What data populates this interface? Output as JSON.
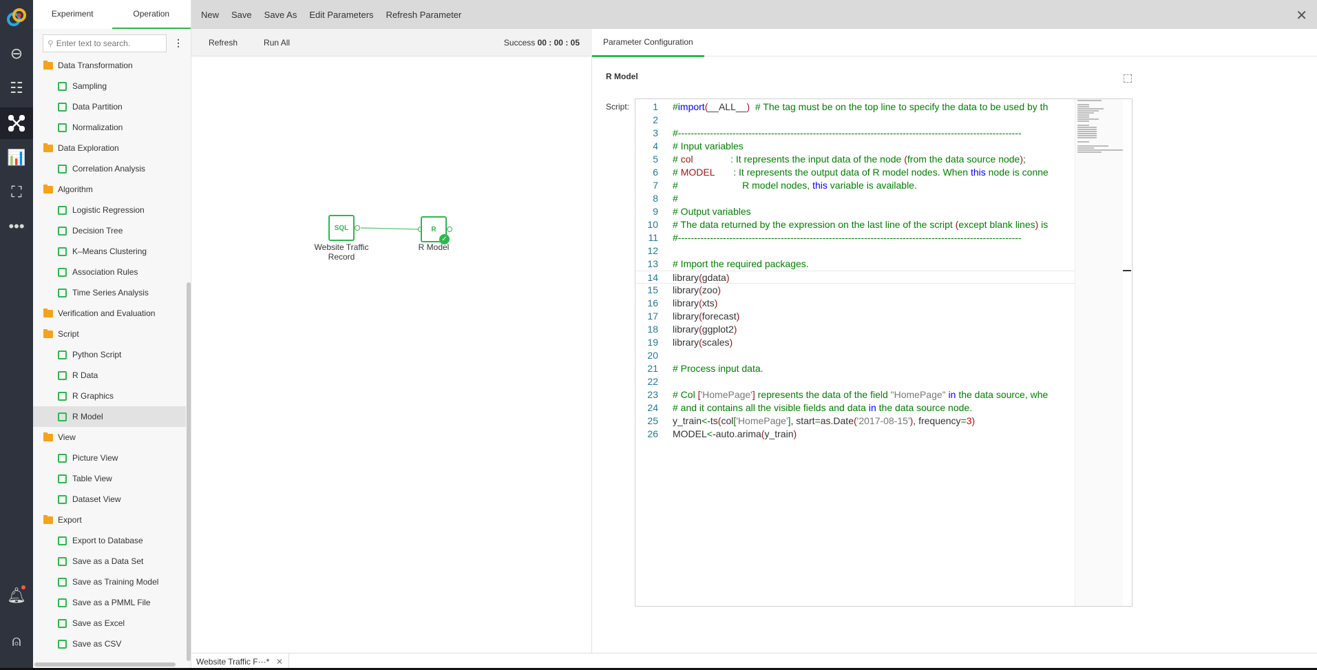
{
  "rail": {
    "icons": [
      "logo-icon",
      "link-icon",
      "list-icon",
      "network-icon",
      "chart-icon",
      "presentation-icon",
      "more-icon",
      "bell-icon",
      "user-icon"
    ],
    "accent": "#2db84d"
  },
  "sidebar": {
    "tabs": [
      "Experiment",
      "Operation"
    ],
    "search_placeholder": "Enter text to search.",
    "tree": [
      {
        "type": "cat",
        "label": "Data Transformation"
      },
      {
        "type": "item",
        "label": "Sampling"
      },
      {
        "type": "item",
        "label": "Data Partition"
      },
      {
        "type": "item",
        "label": "Normalization"
      },
      {
        "type": "cat",
        "label": "Data Exploration"
      },
      {
        "type": "item",
        "label": "Correlation Analysis"
      },
      {
        "type": "cat",
        "label": "Algorithm"
      },
      {
        "type": "item",
        "label": "Logistic Regression"
      },
      {
        "type": "item",
        "label": "Decision Tree"
      },
      {
        "type": "item",
        "label": "K–Means Clustering"
      },
      {
        "type": "item",
        "label": "Association Rules"
      },
      {
        "type": "item",
        "label": "Time Series Analysis"
      },
      {
        "type": "cat",
        "label": "Verification and Evaluation"
      },
      {
        "type": "cat",
        "label": "Script"
      },
      {
        "type": "item",
        "label": "Python Script"
      },
      {
        "type": "item",
        "label": "R Data"
      },
      {
        "type": "item",
        "label": "R Graphics"
      },
      {
        "type": "item",
        "label": "R Model",
        "selected": true
      },
      {
        "type": "cat",
        "label": "View"
      },
      {
        "type": "item",
        "label": "Picture View"
      },
      {
        "type": "item",
        "label": "Table View"
      },
      {
        "type": "item",
        "label": "Dataset View"
      },
      {
        "type": "cat",
        "label": "Export"
      },
      {
        "type": "item",
        "label": "Export to Database"
      },
      {
        "type": "item",
        "label": "Save as a Data Set"
      },
      {
        "type": "item",
        "label": "Save as Training Model"
      },
      {
        "type": "item",
        "label": "Save as a PMML File"
      },
      {
        "type": "item",
        "label": "Save as Excel"
      },
      {
        "type": "item",
        "label": "Save as CSV"
      }
    ]
  },
  "toolbar": {
    "items": [
      "New",
      "Save",
      "Save As",
      "Edit Parameters",
      "Refresh Parameter"
    ]
  },
  "canvas": {
    "refresh": "Refresh",
    "run_all": "Run All",
    "status_label": "Success",
    "status_time": "00 : 00 : 05",
    "nodes": [
      {
        "label": "Website Traffic Record",
        "icon": "SQL"
      },
      {
        "label": "R Model",
        "icon": "R",
        "status": "success"
      }
    ]
  },
  "panel": {
    "tab": "Parameter Configuration",
    "title": "R Model",
    "script_label": "Script:"
  },
  "code": [
    [
      [
        "c",
        "#"
      ],
      [
        "k",
        "import"
      ],
      [
        "o",
        "("
      ],
      [
        "t",
        "__ALL__"
      ],
      [
        "o",
        ")"
      ],
      [
        "c",
        "  # The tag must be on the top line to specify the data to be used by th"
      ]
    ],
    [],
    [
      [
        "c",
        "#-----------------------------------------------------------------------------------------------------------"
      ]
    ],
    [
      [
        "c",
        "# Input variables"
      ]
    ],
    [
      [
        "c",
        "# "
      ],
      [
        "o",
        "col"
      ],
      [
        "c",
        "              : It represents the input data of the node "
      ],
      [
        "o",
        "("
      ],
      [
        "c",
        "from the data source node"
      ],
      [
        "o",
        ")"
      ],
      [
        "c",
        ";"
      ]
    ],
    [
      [
        "c",
        "# "
      ],
      [
        "o",
        "MODEL"
      ],
      [
        "c",
        "       : It represents the output data of R model nodes. When "
      ],
      [
        "k",
        "this"
      ],
      [
        "c",
        " node is conne"
      ]
    ],
    [
      [
        "c",
        "#                        R model nodes, "
      ],
      [
        "k",
        "this"
      ],
      [
        "c",
        " variable is available."
      ]
    ],
    [
      [
        "c",
        "#"
      ]
    ],
    [
      [
        "c",
        "# Output variables"
      ]
    ],
    [
      [
        "c",
        "# The data returned by the expression on the last line of the script "
      ],
      [
        "o",
        "("
      ],
      [
        "c",
        "except blank lines"
      ],
      [
        "o",
        ")"
      ],
      [
        "c",
        " is"
      ]
    ],
    [
      [
        "c",
        "#-----------------------------------------------------------------------------------------------------------"
      ]
    ],
    [],
    [
      [
        "c",
        "# Import the required packages."
      ]
    ],
    [
      [
        "t",
        "library"
      ],
      [
        "o",
        "("
      ],
      [
        "t",
        "gdata"
      ],
      [
        "o",
        ")"
      ]
    ],
    [
      [
        "t",
        "library"
      ],
      [
        "o",
        "("
      ],
      [
        "t",
        "zoo"
      ],
      [
        "o",
        ")"
      ]
    ],
    [
      [
        "t",
        "library"
      ],
      [
        "o",
        "("
      ],
      [
        "t",
        "xts"
      ],
      [
        "o",
        ")"
      ]
    ],
    [
      [
        "t",
        "library"
      ],
      [
        "o",
        "("
      ],
      [
        "t",
        "forecast"
      ],
      [
        "o",
        ")"
      ]
    ],
    [
      [
        "t",
        "library"
      ],
      [
        "o",
        "("
      ],
      [
        "t",
        "ggplot2"
      ],
      [
        "o",
        ")"
      ]
    ],
    [
      [
        "t",
        "library"
      ],
      [
        "o",
        "("
      ],
      [
        "t",
        "scales"
      ],
      [
        "o",
        ")"
      ]
    ],
    [],
    [
      [
        "c",
        "# Process input data."
      ]
    ],
    [],
    [
      [
        "c",
        "# Col "
      ],
      [
        "o",
        "["
      ],
      [
        "s",
        "'HomePage'"
      ],
      [
        "o",
        "]"
      ],
      [
        "c",
        " represents the data of the field "
      ],
      [
        "s",
        "\"HomePage\""
      ],
      [
        "c",
        " "
      ],
      [
        "k",
        "in"
      ],
      [
        "c",
        " the data source, whe"
      ]
    ],
    [
      [
        "c",
        "# and it contains all the visible fields and data "
      ],
      [
        "k",
        "in"
      ],
      [
        "c",
        " the data source node."
      ]
    ],
    [
      [
        "t",
        "y_train"
      ],
      [
        "c",
        "<"
      ],
      [
        "t",
        "-ts"
      ],
      [
        "o",
        "("
      ],
      [
        "t",
        "col"
      ],
      [
        "c",
        "["
      ],
      [
        "s",
        "'HomePage'"
      ],
      [
        "c",
        "]"
      ],
      [
        "t",
        ", start"
      ],
      [
        "c",
        "="
      ],
      [
        "t",
        "as.Date"
      ],
      [
        "o",
        "("
      ],
      [
        "s",
        "'2017-08-15'"
      ],
      [
        "o",
        ")"
      ],
      [
        "t",
        ", frequency"
      ],
      [
        "c",
        "="
      ],
      [
        "n",
        "3"
      ],
      [
        "o",
        ")"
      ]
    ],
    [
      [
        "t",
        "MODEL"
      ],
      [
        "c",
        "<"
      ],
      [
        "t",
        "-auto.arima"
      ],
      [
        "o",
        "("
      ],
      [
        "t",
        "y_train"
      ],
      [
        "o",
        ")"
      ]
    ]
  ],
  "bottom_tabs": [
    {
      "label": "Website Traffic F···*"
    }
  ]
}
